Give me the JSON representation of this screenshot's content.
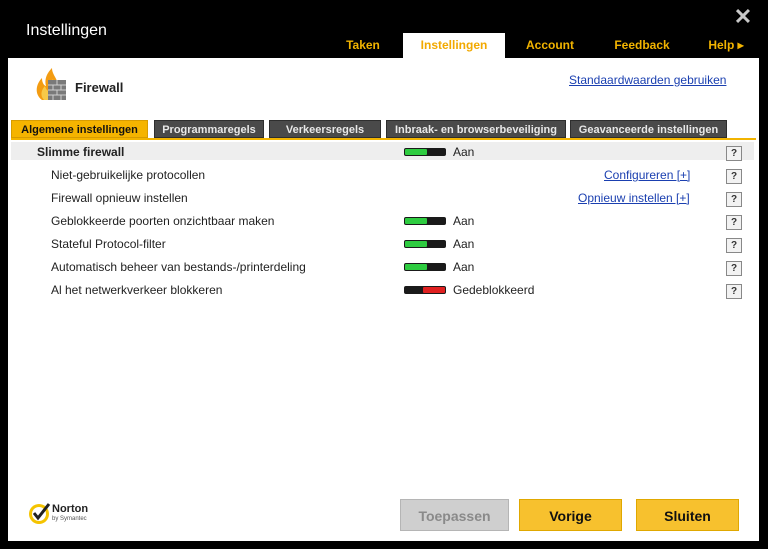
{
  "window": {
    "title": "Instellingen"
  },
  "nav": {
    "tabs": [
      {
        "label": "Taken"
      },
      {
        "label": "Instellingen"
      },
      {
        "label": "Account"
      },
      {
        "label": "Feedback"
      },
      {
        "label": "Help ▸"
      }
    ],
    "active": "Instellingen"
  },
  "section": {
    "title": "Firewall",
    "defaults_link": "Standaardwaarden gebruiken"
  },
  "subtabs": [
    {
      "label": "Algemene instellingen"
    },
    {
      "label": "Programmaregels"
    },
    {
      "label": "Verkeersregels"
    },
    {
      "label": "Inbraak- en browserbeveiliging"
    },
    {
      "label": "Geavanceerde instellingen"
    }
  ],
  "settings": [
    {
      "label": "Slimme firewall",
      "state": "Aan",
      "toggle": "on"
    },
    {
      "label": "Niet-gebruikelijke protocollen",
      "link": "Configureren [+]"
    },
    {
      "label": "Firewall opnieuw instellen",
      "link": "Opnieuw instellen [+]"
    },
    {
      "label": "Geblokkeerde poorten onzichtbaar maken",
      "state": "Aan",
      "toggle": "on"
    },
    {
      "label": "Stateful Protocol-filter",
      "state": "Aan",
      "toggle": "on"
    },
    {
      "label": "Automatisch beheer van bestands-/printerdeling",
      "state": "Aan",
      "toggle": "on"
    },
    {
      "label": "Al het netwerkverkeer blokkeren",
      "state": "Gedeblokkeerd",
      "toggle": "off"
    }
  ],
  "help_label": "?",
  "brand": {
    "name": "Norton",
    "sub": "by Symantec"
  },
  "buttons": {
    "apply": "Toepassen",
    "back": "Vorige",
    "close": "Sluiten"
  },
  "colors": {
    "accent": "#f2b400",
    "toggle_on": "#2ecc40",
    "toggle_off": "#e02020",
    "link": "#1a3fb0"
  },
  "icons": {
    "close": "close-icon",
    "firewall": "firewall-icon",
    "help": "help-icon",
    "norton": "norton-check-icon"
  }
}
